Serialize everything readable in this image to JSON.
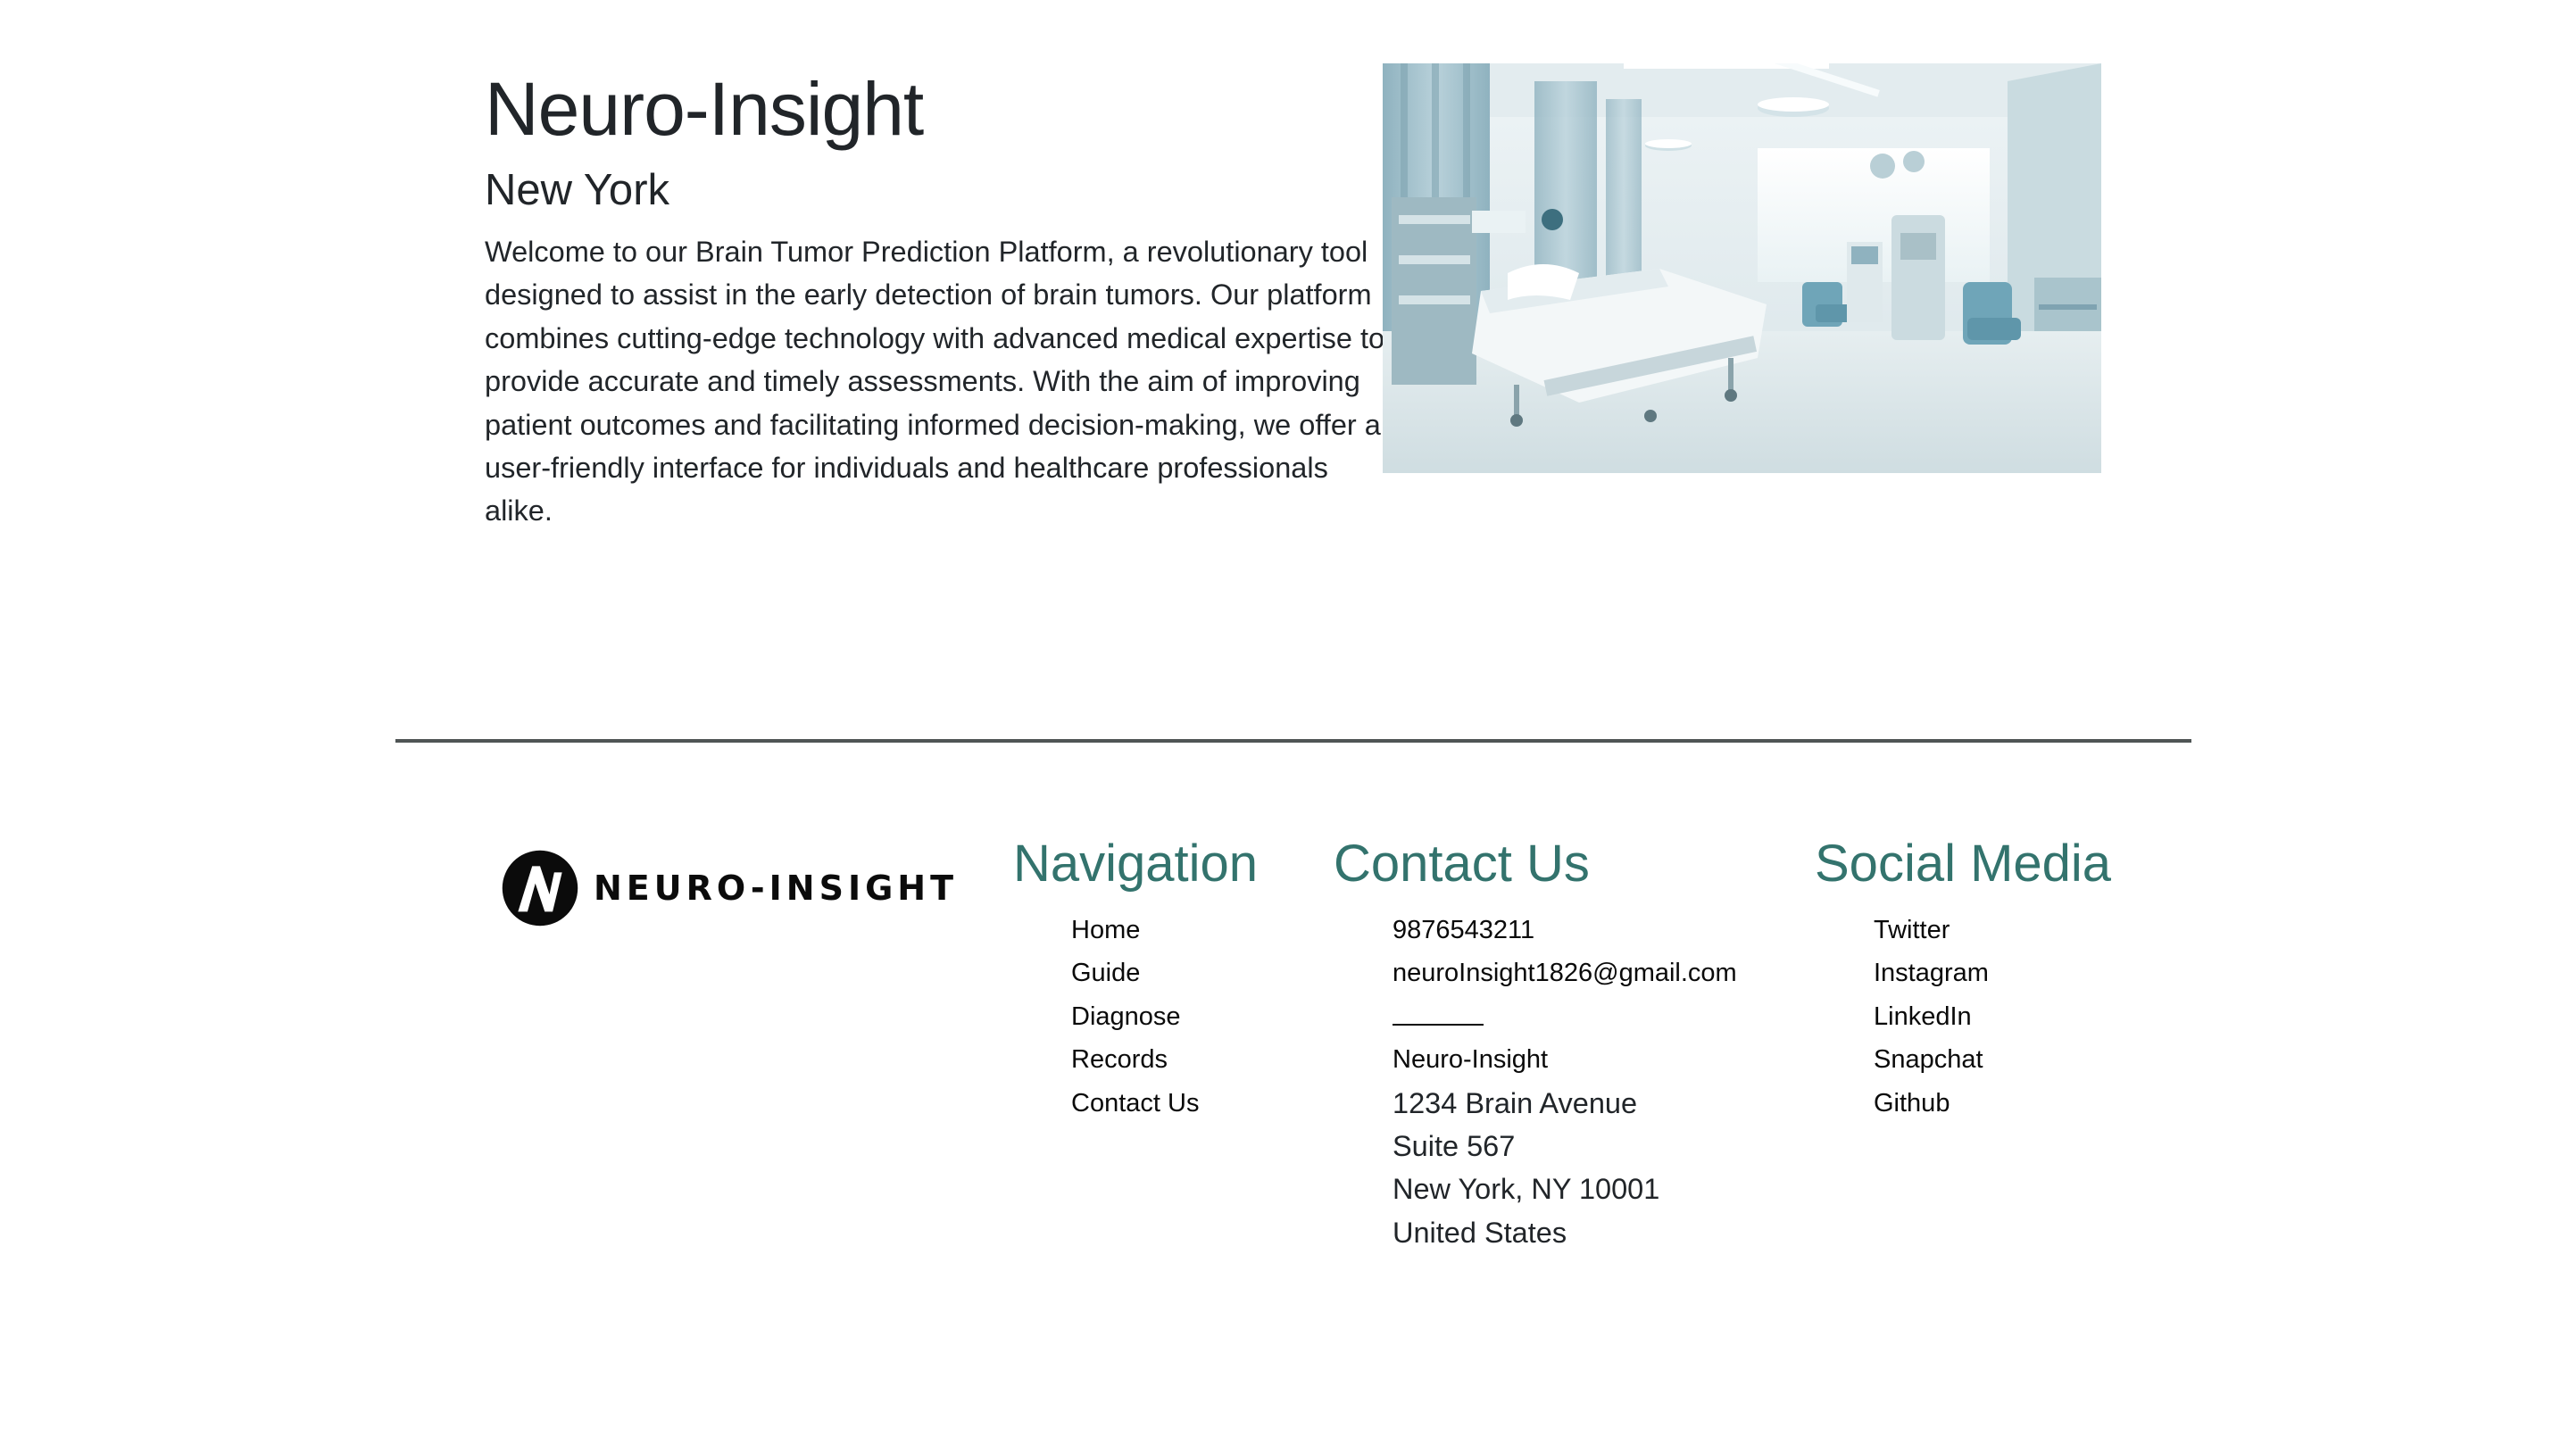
{
  "hero": {
    "title": "Neuro-Insight",
    "subtitle": "New York",
    "description": "Welcome to our Brain Tumor Prediction Platform, a revolutionary tool designed to assist in the early detection of brain tumors. Our platform combines cutting-edge technology with advanced medical expertise to provide accurate and timely assessments. With the aim of improving patient outcomes and facilitating informed decision-making, we offer a user-friendly interface for individuals and healthcare professionals alike.",
    "image_icon": "hospital-room-photo"
  },
  "footer": {
    "logo": {
      "icon": "neuro-insight-logo-mark",
      "wordmark": "NEURO-INSIGHT"
    },
    "navigation": {
      "heading": "Navigation",
      "items": [
        "Home",
        "Guide",
        "Diagnose",
        "Records",
        "Contact Us"
      ]
    },
    "contact": {
      "heading": "Contact Us",
      "phone": "9876543211",
      "email": "neuroInsight1826@gmail.com",
      "company": "Neuro-Insight",
      "address": [
        "1234 Brain Avenue",
        "Suite 567",
        "New York, NY 10001",
        "United States"
      ]
    },
    "social": {
      "heading": "Social Media",
      "items": [
        "Twitter",
        "Instagram",
        "LinkedIn",
        "Snapchat",
        "Github"
      ]
    }
  },
  "colors": {
    "heading_accent": "#33736d",
    "text": "#212529",
    "divider": "#4f5555"
  }
}
